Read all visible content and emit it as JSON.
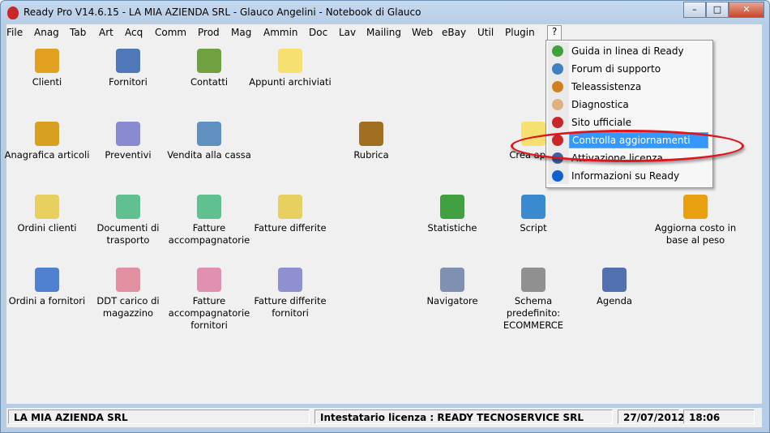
{
  "window": {
    "title": "Ready Pro V14.6.15 - LA MIA AZIENDA SRL - Glauco Angelini - Notebook di Glauco",
    "minimize": "–",
    "maximize": "□",
    "close": "✕"
  },
  "menubar": [
    "File",
    "Anag",
    "Tab",
    "Art",
    "Acq",
    "Comm",
    "Prod",
    "Mag",
    "Ammin",
    "Doc",
    "Lav",
    "Mailing",
    "Web",
    "eBay",
    "Util",
    "Plugin",
    "?"
  ],
  "desktop": [
    {
      "label": "Clienti",
      "icon": "clients-icon",
      "color": "#e0a020"
    },
    {
      "label": "Fornitori",
      "icon": "suppliers-icon",
      "color": "#5078b8"
    },
    {
      "label": "Contatti",
      "icon": "contacts-icon",
      "color": "#70a040"
    },
    {
      "label": "Appunti archiviati",
      "icon": "notes-icon",
      "color": "#f5e070"
    },
    {
      "label": "Anagrafica articoli",
      "icon": "box-icon",
      "color": "#d8a020"
    },
    {
      "label": "Preventivi",
      "icon": "quote-icon",
      "color": "#8a8ad0"
    },
    {
      "label": "Vendita alla cassa",
      "icon": "cash-register-icon",
      "color": "#6090c0"
    },
    {
      "label": "Rubrica",
      "icon": "address-book-icon",
      "color": "#a07020"
    },
    {
      "label": "Ordini clienti",
      "icon": "customer-orders-icon",
      "color": "#e8d060"
    },
    {
      "label": "Documenti di trasporto",
      "icon": "transport-docs-icon",
      "color": "#60c090"
    },
    {
      "label": "Fatture accompagnatorie",
      "icon": "invoice-icon",
      "color": "#60c090"
    },
    {
      "label": "Fatture differite",
      "icon": "deferred-invoice-icon",
      "color": "#e8d060"
    },
    {
      "label": "Statistiche",
      "icon": "chart-icon",
      "color": "#40a040"
    },
    {
      "label": "Script",
      "icon": "globe-icon",
      "color": "#3a8ad0"
    },
    {
      "label": "Aggiorna costo in base al peso",
      "icon": "euro-coin-icon",
      "color": "#e8a010"
    },
    {
      "label": "Ordini a fornitori",
      "icon": "supplier-orders-icon",
      "color": "#5080d0"
    },
    {
      "label": "DDT carico di magazzino",
      "icon": "warehouse-ddt-icon",
      "color": "#e090a0"
    },
    {
      "label": "Fatture accompagnatorie fornitori",
      "icon": "supplier-invoice-icon",
      "color": "#e090b0"
    },
    {
      "label": "Fatture differite fornitori",
      "icon": "supplier-deferred-invoice-icon",
      "color": "#9090d0"
    },
    {
      "label": "Navigatore",
      "icon": "compass-icon",
      "color": "#8090b0"
    },
    {
      "label": "Schema predefinito: ECOMMERCE",
      "icon": "wrench-icon",
      "color": "#909090"
    },
    {
      "label": "Agenda",
      "icon": "calendar-icon",
      "color": "#5070b0"
    },
    {
      "label": "Crea appu",
      "icon": "note-create-icon",
      "color": "#f5e070"
    }
  ],
  "help_menu": [
    {
      "label": "Guida in linea di Ready",
      "icon": "help-icon",
      "color": "#40a040"
    },
    {
      "label": "Forum di supporto",
      "icon": "forum-icon",
      "color": "#4080c0"
    },
    {
      "label": "Teleassistenza",
      "icon": "remote-support-icon",
      "color": "#d08020"
    },
    {
      "label": "Diagnostica",
      "icon": "doctor-icon",
      "color": "#e0b080"
    },
    {
      "label": "Sito ufficiale",
      "icon": "strawberry-icon",
      "color": "#c8262a"
    },
    {
      "label": "Controlla aggiornamenti",
      "icon": "strawberry-icon",
      "color": "#c8262a",
      "selected": true
    },
    {
      "label": "Attivazione licenza",
      "icon": "license-icon",
      "color": "#4060a0"
    },
    {
      "label": "Informazioni su Ready",
      "icon": "info-icon",
      "color": "#1060d0"
    }
  ],
  "statusbar": {
    "company": "LA MIA AZIENDA SRL",
    "license": "Intestatario licenza : READY TECNOSERVICE SRL",
    "date": "27/07/2012",
    "time": "18:06"
  }
}
